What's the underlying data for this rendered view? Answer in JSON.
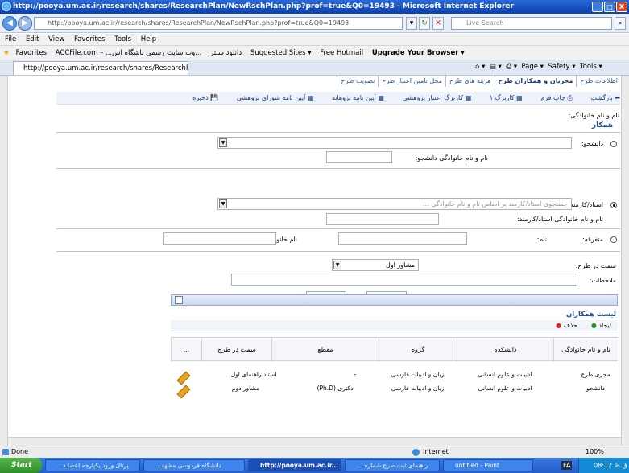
{
  "window": {
    "title": "http://pooya.um.ac.ir/research/shares/ResearchPlan/NewRschPlan.php?prof=true&Q0=19493 - Microsoft Internet Explorer",
    "minimize": "_",
    "maximize": "□",
    "close": "X"
  },
  "address": {
    "url": "http://pooya.um.ac.ir/research/shares/ResearchPlan/NewRschPlan.php?prof=true&Q0=19493",
    "search_placeholder": "Live Search"
  },
  "menu": [
    "File",
    "Edit",
    "View",
    "Favorites",
    "Tools",
    "Help"
  ],
  "favorites": {
    "label": "Favorites",
    "items": [
      "ACCFile.com – ...دانلود سنتر",
      "...وب سایت رسمی باشگاه اس",
      "Suggested Sites ▾",
      "Free Hotmail",
      "Upgrade Your Browser ▾"
    ]
  },
  "tab": {
    "label": "http://pooya.um.ac.ir/research/shares/ResearchPlan...",
    "tools": [
      "Page ▾",
      "Safety ▾",
      "Tools ▾"
    ]
  },
  "page_tabs": [
    "اطلاعات طرح",
    "مجریان و همکاران طرح",
    "هزینه های طرح",
    "محل تامین اعتبار طرح",
    "تصویب طرح"
  ],
  "page_toolbar": [
    "بازگشت",
    "چاپ فرم",
    "کاربرگ ۱",
    "کاربرگ اعتبار پژوهشی",
    "آیین نامه پژوهانه",
    "آیین نامه شورای پژوهشی",
    "ذخیره"
  ],
  "form": {
    "top_label": "نام و نام خانوادگی:",
    "section_title": "همکار",
    "student_label": "دانشجو:",
    "student_name_label": "نام و نام خانوادگی دانشجو:",
    "staff_label": "استاد/کارمند:",
    "staff_placeholder": "جستجوی استاد/کارمند بر اساس نام و نام خانوادگی ...",
    "staff_name_label": "نام و نام خانوادگی استاد/کارمند:",
    "other_label": "متفرقه:",
    "first_name_label": "نام:",
    "last_name_label": "نام خانوادگی:",
    "role_label": "سمت در طرح:",
    "role_value": "مشاور اول",
    "notes_label": "ملاحظات:",
    "save_button": "ذخیره",
    "cancel_button": "انصراف"
  },
  "grid": {
    "title": "لیست همکاران",
    "add_label": "ایجاد",
    "delete_label": "حذف",
    "columns": [
      "نام و نام خانوادگی",
      "دانشکده",
      "گروه",
      "مقطع",
      "سمت در طرح",
      "..."
    ],
    "rows": [
      {
        "role_left": "مجری طرح",
        "faculty": "ادبیات و علوم انسانی",
        "group": "زبان و ادبیات فارسی",
        "degree": "-",
        "role": "استاد راهنمای اول"
      },
      {
        "role_left": "دانشجو",
        "faculty": "ادبیات و علوم انسانی",
        "group": "زبان و ادبیات فارسی",
        "degree": "دکتری (Ph.D)",
        "role": "مشاور دوم"
      }
    ]
  },
  "status": {
    "left": "Done",
    "zone": "Internet",
    "zoom": "100%"
  },
  "taskbar": {
    "start": "Start",
    "tasks": [
      "...پرتال ورود یکپارچه اعضا د",
      "...دانشگاه فردوسی مشهد",
      "http://pooya.um.ac.ir...",
      "... راهنمای ثبت طرح شماره",
      "untitled - Paint"
    ],
    "lang": "FA",
    "clock": "08:12 ق.ظ"
  },
  "colors": {
    "accent": "#1c4f9e",
    "titlebar": "#0a3fae"
  }
}
